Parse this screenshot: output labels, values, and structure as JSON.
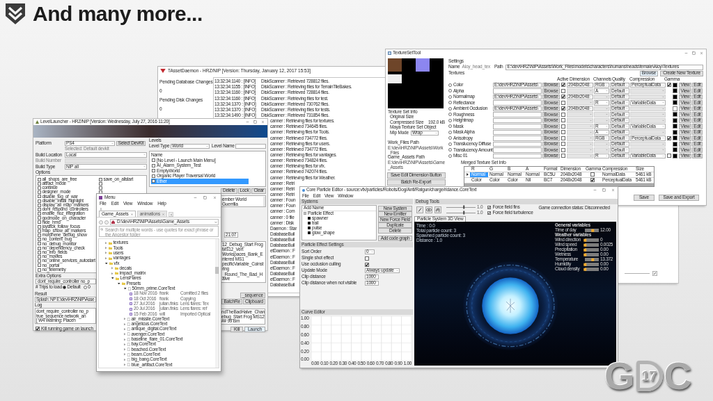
{
  "slide": {
    "title": "And many more..."
  },
  "asset_daemon": {
    "title": "TAssetDaemon - HRZ/NIP [Version: Thursday, January 12, 2017 15:53]",
    "status": [
      {
        "label": "Pending Database Changes",
        "value": "0"
      },
      {
        "label": "Pending Disk Changes",
        "value": "0"
      }
    ],
    "log": [
      {
        "kind": "entry",
        "time": "13:32:34:1140 : [INFO]",
        "message": "DiskScanner : Retrieved 728812 files."
      },
      {
        "kind": "entry",
        "time": "13:32:34:1155 : [INFO]",
        "message": "DiskScanner : Retrieving files for TerrainTileBakes."
      },
      {
        "kind": "entry",
        "time": "13:32:34:1160 : [INFO]",
        "message": "DiskScanner : Retrieved 728814 files."
      },
      {
        "kind": "entry",
        "time": "13:32:34:1160 : [INFO]",
        "message": "DiskScanner : Retrieving files for test."
      },
      {
        "kind": "entry",
        "time": "13:32:34:1370 : [INFO]",
        "message": "DiskScanner : Retrieved 730762 files."
      },
      {
        "kind": "entry",
        "time": "13:32:34:1370 : [INFO]",
        "message": "DiskScanner : Retrieving files for tests."
      },
      {
        "kind": "entry",
        "time": "13:32:34:1490 : [INFO]",
        "message": "DiskScanner : Retrieved 731854 files."
      },
      {
        "kind": "clipped",
        "message": "canner : Retrieving files for textures."
      },
      {
        "kind": "clipped",
        "message": "canner : Retrieved 734645 files."
      },
      {
        "kind": "clipped",
        "message": "canner : Retrieving files for Tools."
      },
      {
        "kind": "clipped",
        "message": "canner : Retrieved 734772 files."
      },
      {
        "kind": "clipped",
        "message": "canner : Retrieving files for users."
      },
      {
        "kind": "clipped",
        "message": "canner : Retrieved 734772 files."
      },
      {
        "kind": "clipped",
        "message": "canner : Retrieving files for vantages."
      },
      {
        "kind": "clipped",
        "message": "canner : Retrieved 734824 files."
      },
      {
        "kind": "clipped",
        "message": "canner : Retrieving files for vfx."
      },
      {
        "kind": "clipped",
        "message": "canner : Retrieved 742074 files."
      },
      {
        "kind": "clipped",
        "message": "canner : Retrieving files for Weather."
      },
      {
        "kind": "clipped",
        "message": "canner : Retri"
      },
      {
        "kind": "clipped",
        "message": "canner : Retri"
      },
      {
        "kind": "clipped",
        "message": "canner : Retri"
      },
      {
        "kind": "clipped",
        "message": "canner : Foun"
      },
      {
        "kind": "clipped",
        "message": "canner : Foun"
      },
      {
        "kind": "clipped",
        "message": "canner : Com"
      },
      {
        "kind": "clipped",
        "message": "canner : 0 file"
      },
      {
        "kind": "clipped",
        "message": "canner : Disk"
      },
      {
        "kind": "clipped",
        "message": "Daemon : Star"
      },
      {
        "kind": "clipped",
        "message": "DatabaseBuil"
      },
      {
        "kind": "clipped",
        "message": "DatabaseBuil"
      },
      {
        "kind": "clipped",
        "message": "DatabaseBuil"
      },
      {
        "kind": "clipped",
        "message": "etDaemon : F"
      },
      {
        "kind": "clipped",
        "message": "etDaemon : F"
      },
      {
        "kind": "clipped",
        "message": "DatabaseBuil"
      },
      {
        "kind": "clipped",
        "message": "etDaemon : F"
      },
      {
        "kind": "clipped",
        "message": "DatabaseBuil"
      },
      {
        "kind": "clipped",
        "message": "etDaemon : F"
      },
      {
        "kind": "clipped",
        "message": "DatabaseBuil"
      }
    ]
  },
  "texture_tool": {
    "title": "TextureSetTool",
    "info": {
      "heading": "Texture Set Info",
      "original_size_label": "Original Size",
      "compressed_size_label": "Compressed Size",
      "compressed_size": "192.0 kB",
      "maya_object_label": "Maya Texture Set Object",
      "mip_mode_label": "Mip Mode",
      "mip_mode": "Wrap"
    },
    "paths": [
      {
        "label": "Work_Files Path",
        "value": "E:\\dev\\HRZ\\NIP\\Assets\\Work_Files"
      },
      {
        "label": "Game_Assets Path",
        "value": "E:\\dev\\HRZ\\NIP\\Assets\\Game_Assets"
      }
    ],
    "side_buttons": [
      "Save Edit Dimension Button",
      "Batch Re-Export"
    ],
    "settings_heading": "Settings",
    "name_label": "Name",
    "name_value": "Aloy_head_tex",
    "path_label": "Path",
    "path_value": "E:\\dev\\HRZ\\NIP\\Assets\\Work_Files\\models\\characters\\humans\\heads\\female\\Aloy\\Textures",
    "top_buttons": [
      "Browse",
      "Create New Texture"
    ],
    "textures_heading": "Textures",
    "columns": [
      "Active",
      "Dimension",
      "Channels",
      "Quality",
      "Compression",
      "Gamma"
    ],
    "rows": [
      {
        "label": "Color",
        "selected": false,
        "path": "E:\\dev\\HRZ\\NIP\\Assets\\",
        "browse": "Browse",
        "active": true,
        "dimension": "2048x2048",
        "channels": "RGB",
        "quality": "Default",
        "compression": "PerceptualData",
        "gamma": true,
        "color": "#000000",
        "view": "View",
        "edit": "Edit"
      },
      {
        "label": "Alpha",
        "selected": false,
        "browse": "Browse",
        "active": false,
        "channels": "A",
        "quality": "Default",
        "color": "#000000",
        "view": "View",
        "edit": "Edit"
      },
      {
        "label": "Normalmap",
        "selected": false,
        "path": "E:\\dev\\HRZ\\NIP\\Assets\\",
        "browse": "Browse",
        "active": true,
        "dimension": "2048x2048",
        "quality": "Default",
        "color": "#000000",
        "view": "View",
        "edit": "Edit"
      },
      {
        "label": "Reflectance",
        "selected": false,
        "browse": "Browse",
        "active": false,
        "channels": "R",
        "quality": "Default",
        "compression": "VariableData",
        "color": "#000000",
        "view": "View",
        "edit": "Edit"
      },
      {
        "label": "Ambient Occlusion",
        "selected": false,
        "path": "E:\\dev\\HRZ\\NIP\\Assets\\",
        "browse": "Browse",
        "active": true,
        "dimension": "2048x2048",
        "quality": "Default",
        "color": "#ffffff",
        "view": "View",
        "edit": "Edit"
      },
      {
        "label": "Roughness",
        "selected": false,
        "browse": "Browse",
        "active": false,
        "quality": "Default",
        "color": "#000000",
        "view": "View",
        "edit": "Edit"
      },
      {
        "label": "Heightmap",
        "selected": false,
        "browse": "Browse",
        "active": false,
        "quality": "Default",
        "color": "#000000",
        "view": "View",
        "edit": "Edit"
      },
      {
        "label": "Mask",
        "selected": false,
        "browse": "Browse",
        "active": false,
        "channels": "R",
        "quality": "Default",
        "compression": "VariableData",
        "color": "#000000",
        "view": "View",
        "edit": "Edit"
      },
      {
        "label": "Mask Alpha",
        "selected": false,
        "browse": "Browse",
        "active": false,
        "channels": "A",
        "quality": "Default",
        "color": "#000000",
        "view": "View",
        "edit": "Edit"
      },
      {
        "label": "Anisotropy",
        "selected": false,
        "browse": "Browse",
        "active": false,
        "channels": "RGB",
        "quality": "Default",
        "compression": "PerceptualData",
        "gamma": true,
        "color": "#000000",
        "view": "View",
        "edit": "Edit"
      },
      {
        "label": "Translucency Diffuse",
        "selected": false,
        "browse": "Browse",
        "active": false,
        "quality": "Default",
        "color": "#000000",
        "view": "View",
        "edit": "Edit"
      },
      {
        "label": "Translucency Amount",
        "selected": false,
        "browse": "Browse",
        "active": false,
        "quality": "Default",
        "color": "#000000",
        "view": "View",
        "edit": "Edit"
      },
      {
        "label": "Misc 01",
        "selected": false,
        "browse": "Browse",
        "active": false,
        "channels": "R",
        "quality": "Default",
        "compression": "VariableData",
        "gamma": false,
        "color": "#000000",
        "view": "View",
        "edit": "Edit"
      }
    ],
    "merged": {
      "title": "Merged Texture Set Info",
      "columns": [
        "R",
        "G",
        "B",
        "A",
        "Format",
        "Dimension",
        "Gamma",
        "Compression",
        "Size"
      ],
      "rows": [
        {
          "selected": true,
          "r": "Normal",
          "g": "Normal",
          "b": "Normal",
          "a": "Normal",
          "format": "BC5U",
          "dimension": "2048x2048",
          "gamma": false,
          "compression": "NormalData",
          "size": "5461 kB"
        },
        {
          "selected": false,
          "r": "Color",
          "g": "Color",
          "b": "Color",
          "a": "Nil",
          "format": "BC7",
          "dimension": "2048x2048",
          "gamma": true,
          "compression": "PerceptualData",
          "size": "5461 kB"
        }
      ]
    },
    "bottom_buttons": [
      "Save",
      "Save and Export"
    ]
  },
  "level_launcher": {
    "title": "LevelLauncher - HRZ/NIP [Version: Wednesday, July 27, 2016 11:20]",
    "platform": {
      "label": "Platform",
      "value": "PS4",
      "button": "Select DevKit",
      "note": "Selected: Default devkit"
    },
    "build_location": {
      "label": "Build Location",
      "value": "Local"
    },
    "build_number": {
      "label": "Build Number",
      "disabled": true
    },
    "build_type": {
      "label": "Build Type",
      "value": "NIP all"
    },
    "options": {
      "label": "Options",
      "column_1": [
        {
          "label": "all_shops_are_free",
          "checked": false
        },
        {
          "label": "attract_mode",
          "checked": false
        },
        {
          "label": "continue",
          "checked": false
        },
        {
          "label": "designer_mode",
          "checked": false
        },
        {
          "label": "disable_fog_of_war",
          "checked": false
        },
        {
          "label": "disable_initial_highlight",
          "checked": false
        },
        {
          "label": "display_all_map_markers",
          "checked": false
        },
        {
          "label": "dont_respond_controllers",
          "checked": false
        },
        {
          "label": "enable_hoz_integration",
          "checked": false
        },
        {
          "label": "godmode_on_character",
          "checked": false
        },
        {
          "label": "hide_hmd",
          "checked": false
        },
        {
          "label": "joystick_follow_focus",
          "checked": false
        },
        {
          "label": "map_show_all_markers",
          "checked": false
        },
        {
          "label": "morphene_debug_show",
          "checked": false
        },
        {
          "label": "no_content_bug",
          "checked": false
        },
        {
          "label": "no_debug_monitor",
          "checked": false
        },
        {
          "label": "no_dependency_check",
          "checked": false
        },
        {
          "label": "no_info_fields",
          "checked": false
        },
        {
          "label": "no_movies",
          "checked": false
        },
        {
          "label": "no_online_services_autostart",
          "checked": false
        },
        {
          "label": "no_portal",
          "checked": false
        },
        {
          "label": "no_telemetry",
          "checked": false
        }
      ],
      "column_2": [
        {
          "label": "save_on_allstart",
          "checked": false
        },
        {
          "checked": false
        },
        {
          "checked": false
        },
        {
          "checked": false
        }
      ]
    },
    "extra_options": {
      "label": "Extra Options",
      "value": "dont_require_controller no_p"
    },
    "trips": {
      "label": "# Trips to load",
      "choices": [
        {
          "label": "Default",
          "selected": true
        },
        {
          "label": "0",
          "selected": false
        }
      ]
    },
    "result": {
      "label": "Result",
      "value": "Splash: NP E:\\dev\\HRZ\\NIP\\Asse"
    },
    "log": {
      "label": "Log",
      "lines": [
        "dont_require_controller no_p",
        "true_sequence network_an",
        "[ W4 Warning: Placeh"
      ],
      "line_ends": [
        "ndTheBadHalve_Chan",
        "ebug_Start Frog MS12",
        "## 99 Bm"
      ]
    },
    "kill_on_launch": {
      "label": "Kill running game on launch",
      "checked": true
    },
    "levels": {
      "label": "Levels",
      "type_label": "Level Type",
      "type": "World",
      "name_label": "Level Name",
      "list_header": "Name",
      "items": [
        {
          "label": "[No Level - Launch Main Menu]",
          "checked": false,
          "selected": false
        },
        {
          "label": "AI_Alarm_System_Test",
          "checked": false,
          "selected": false
        },
        {
          "label": "EmptyWorld",
          "checked": false,
          "selected": false
        },
        {
          "label": "Organic Player Traversal World",
          "checked": false,
          "selected": false
        },
        {
          "label": "Ether",
          "checked": false,
          "selected": true
        }
      ]
    },
    "level_buttons": [
      "Delete",
      "Lock",
      "Clear"
    ],
    "description": "ember World Guerrilla",
    "time_field": "21:07",
    "side_log": [
      "12_Debug_Start Frog MS12_Vert",
      "Workspaces_Bank_Entered MS1",
      "pecificVariable_Coinstring",
      "_Round_The_Bad_Halve"
    ],
    "result_buttons": [
      "_sequence",
      "BatchRe",
      "Clipboard"
    ],
    "launch_buttons": [
      "Kill",
      "Launch"
    ]
  },
  "file_browser": {
    "title": "Menu",
    "menus": [
      "File",
      "Edit",
      "View",
      "Window",
      "Help"
    ],
    "tabs": [
      {
        "label": "Game_Assets",
        "selected": true
      },
      {
        "label": "animations",
        "selected": false
      }
    ],
    "path": "D:\\dev\\HRZ\\NIP\\Assets\\Game_Assets",
    "search_placeholder": "Search for multiple words - use quotes for exact phrase or the Ancestor folder",
    "tree": [
      {
        "kind": "folder",
        "label": "textures",
        "expanded": false
      },
      {
        "kind": "folder",
        "label": "Tools",
        "expanded": false
      },
      {
        "kind": "folder",
        "label": "users",
        "expanded": false
      },
      {
        "kind": "folder",
        "label": "vantages",
        "expanded": false
      },
      {
        "kind": "folder",
        "label": "vfx",
        "expanded": true,
        "children": [
          {
            "kind": "folder",
            "label": "decals",
            "expanded": false
          },
          {
            "kind": "folder",
            "label": "impact_matrix",
            "expanded": false
          },
          {
            "kind": "folder",
            "label": "LensFlares",
            "expanded": true,
            "children": [
              {
                "kind": "folder",
                "label": "Presets",
                "expanded": true,
                "children": [
                  {
                    "kind": "file",
                    "label": "50mm_prime.CoreText",
                    "expanded": true,
                    "children": [
                      {
                        "kind": "revision",
                        "date": "18 Nov 2016",
                        "user": "frank",
                        "comment": "Comitted 2 files"
                      },
                      {
                        "kind": "revision",
                        "date": "18 Oct 2016",
                        "user": "frank",
                        "comment": "Copying"
                      },
                      {
                        "kind": "revision",
                        "date": "27 Jul 2016",
                        "user": "julian.finks",
                        "comment": "Lens flares: Tex"
                      },
                      {
                        "kind": "revision",
                        "date": "20 Jul 2016",
                        "user": "julian.finks",
                        "comment": "Lens flares: ref"
                      },
                      {
                        "kind": "revision",
                        "date": "15 Feb 2016",
                        "user": "will",
                        "comment": "Imported Optical"
                      }
                    ]
                  },
                  {
                    "kind": "file",
                    "label": "air_missile.CoreText",
                    "expanded": false
                  },
                  {
                    "kind": "file",
                    "label": "angelicus.CoreText",
                    "expanded": false
                  },
                  {
                    "kind": "file",
                    "label": "antique_digital.CoreText",
                    "expanded": false
                  },
                  {
                    "kind": "file",
                    "label": "avenger.CoreText",
                    "expanded": false
                  },
                  {
                    "kind": "file",
                    "label": "baseline_flare_01.CoreText",
                    "expanded": false
                  },
                  {
                    "kind": "file",
                    "label": "bay.CoreText",
                    "expanded": false
                  },
                  {
                    "kind": "file",
                    "label": "beached.CoreText",
                    "expanded": false
                  },
                  {
                    "kind": "file",
                    "label": "beam.CoreText",
                    "expanded": false
                  },
                  {
                    "kind": "file",
                    "label": "big_bang.CoreText",
                    "expanded": false
                  },
                  {
                    "kind": "file",
                    "label": "blue_artifact.CoreText",
                    "expanded": false
                  }
                ]
              }
            ]
          }
        ]
      }
    ]
  },
  "particle_editor": {
    "title": "Core Particle Editor - source:vfx/particles/Robots/Dog/Antl/Ratgun/charge/ridance.CoreText",
    "menus": [
      "File",
      "Edit",
      "View",
      "Window"
    ],
    "systems": {
      "heading": "Systems",
      "name_header": "Add Name",
      "tree": {
        "label": "Particle Effect",
        "expanded": true,
        "children": [
          {
            "label": "spawner"
          },
          {
            "label": "trail"
          },
          {
            "label": "pulse"
          },
          {
            "label": "glow_shape"
          }
        ]
      },
      "buttons": [
        "New System",
        "New Emitter",
        "New Force Field",
        "Duplicate",
        "Delete",
        "Add code graph"
      ]
    },
    "settings": {
      "heading": "Particle Effect Settings",
      "rows": [
        {
          "kind": "dropdown",
          "label": "Sort Order",
          "value": "0"
        },
        {
          "kind": "checkbox",
          "label": "Single shot effect",
          "checked": false
        },
        {
          "kind": "checkbox",
          "label": "Use occlusion culling",
          "checked": true
        },
        {
          "kind": "dropdown",
          "label": "Update Mode",
          "value": "Always update"
        },
        {
          "kind": "field",
          "label": "Clip distance",
          "value": "1000"
        },
        {
          "kind": "field",
          "label": "Clip distance when not visible",
          "value": "1000"
        }
      ]
    },
    "curve_editor": {
      "heading": "Curve Editor",
      "y_ticks": [
        "1.00",
        "0.80",
        "0.60",
        "0.40",
        "0.20",
        "0.00"
      ],
      "x_ticks": [
        "0.00",
        "0.10",
        "0.20",
        "0.30",
        "0.40",
        "0.50",
        "0.60",
        "0.70",
        "0.80",
        "0.90",
        "1.00"
      ]
    },
    "debug_tools": {
      "heading": "Debug Tools",
      "sliders": [
        {
          "level": 0.6,
          "reading": "1.0"
        },
        {
          "level": 0.6,
          "reading": "1.0"
        }
      ],
      "toggles": [
        {
          "label": "Force field fins",
          "checked": true
        },
        {
          "label": "Force field turbulence",
          "checked": true
        }
      ],
      "status": "Game connection status: Disconnected"
    },
    "view_tab": {
      "label": "Particle System 3D View",
      "selected": true
    },
    "stats": [
      "Time : 0.0",
      "Total particle count: 3",
      "Spawned particle count: 3",
      "Distance : 1.0"
    ],
    "variables": [
      {
        "kind": "heading",
        "label": "General variables"
      },
      {
        "kind": "slider",
        "label": "Time of day",
        "level": 0.55,
        "value": "12.00"
      },
      {
        "kind": "heading",
        "label": "Weather variables"
      },
      {
        "kind": "slider",
        "label": "Wind direction",
        "level": 0,
        "value": "0"
      },
      {
        "kind": "slider",
        "label": "Wind speed",
        "level": 0,
        "value": "0.0025"
      },
      {
        "kind": "slider",
        "label": "Precipitation",
        "level": 0,
        "value": "0.00"
      },
      {
        "kind": "slider",
        "label": "Wetness",
        "level": 0,
        "value": "0.00"
      },
      {
        "kind": "slider",
        "label": "Temperature",
        "level": 0.55,
        "value": "13.372"
      },
      {
        "kind": "slider",
        "label": "Humidity",
        "level": 0,
        "value": "0.00"
      },
      {
        "kind": "slider",
        "label": "Cloud density",
        "level": 0,
        "value": "0.00"
      }
    ]
  },
  "gdc_logo": {
    "left": "G",
    "badge": "17",
    "right": "C"
  }
}
